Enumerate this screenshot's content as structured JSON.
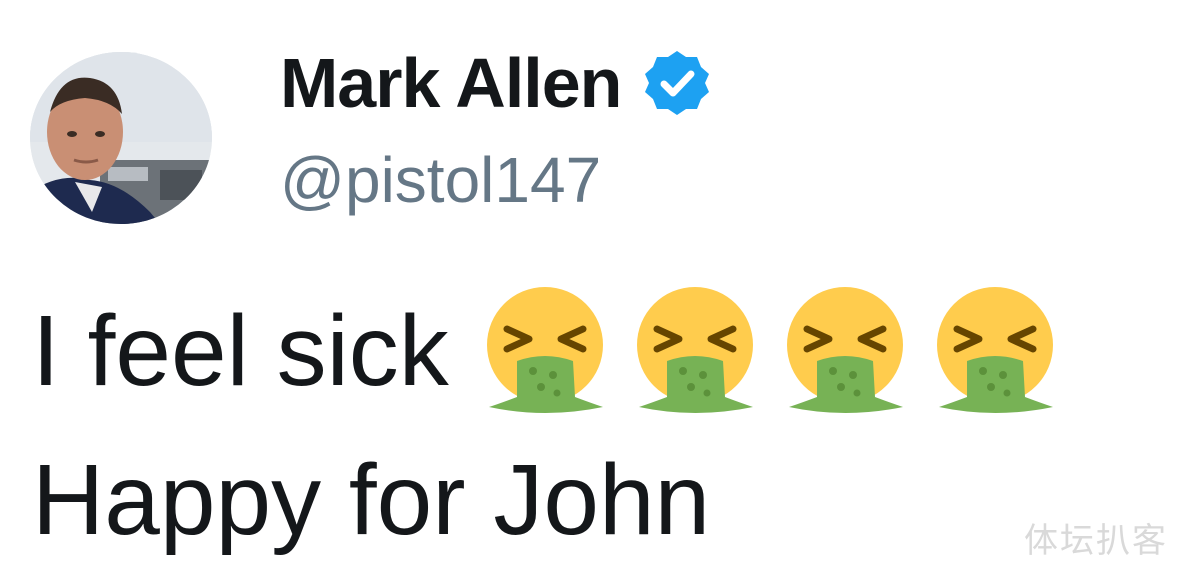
{
  "profile": {
    "display_name": "Mark Allen",
    "handle": "@pistol147",
    "verified": true,
    "avatar": "profile-photo"
  },
  "tweet": {
    "line1_text": "I feel sick",
    "emoji": [
      "nauseated-vomiting-face",
      "nauseated-vomiting-face",
      "nauseated-vomiting-face",
      "nauseated-vomiting-face"
    ],
    "line2_text": "Happy for John"
  },
  "watermark": "体坛扒客",
  "colors": {
    "text": "#14171a",
    "handle": "#657786",
    "verified_blue": "#1da1f2",
    "emoji_yellow": "#ffcc4d",
    "emoji_green": "#77b255"
  }
}
